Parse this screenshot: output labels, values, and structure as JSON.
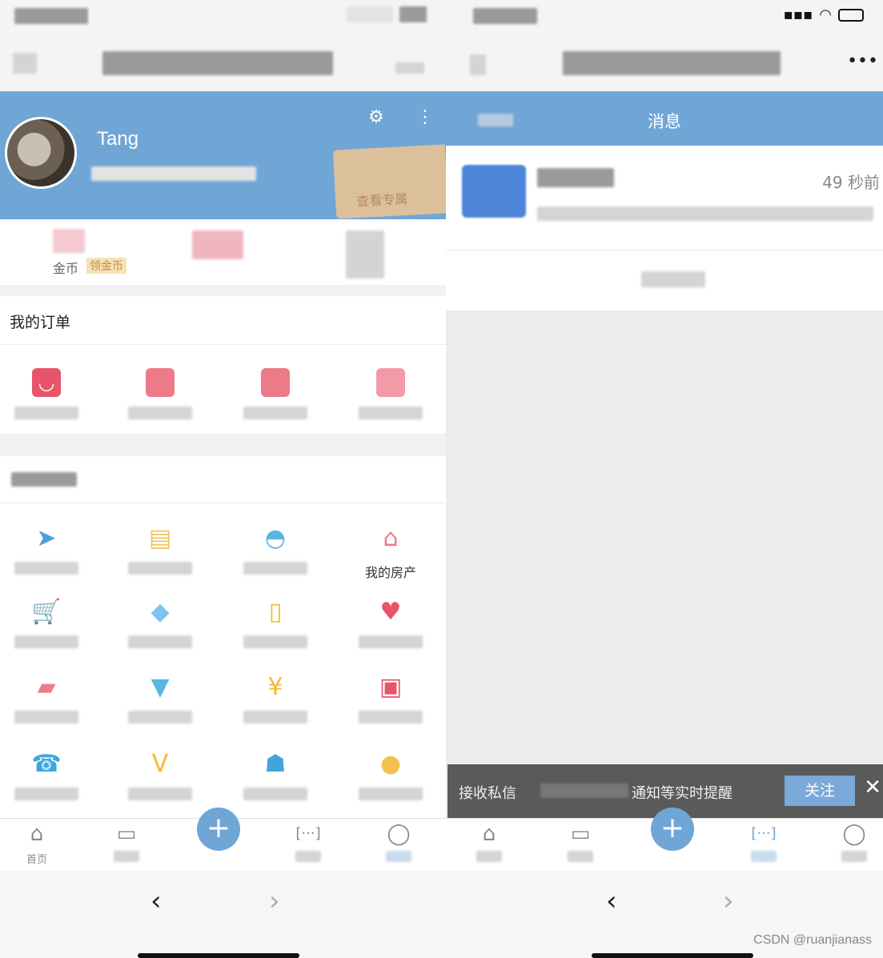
{
  "left": {
    "profile": {
      "name": "Tang",
      "view_button": "查看专属",
      "settings_icon": "gear-icon",
      "more_icon": "more-vertical-icon"
    },
    "coins": {
      "label": "金币",
      "sub_label": "领金币"
    },
    "orders": {
      "title": "我的订单"
    },
    "services": {
      "items": [
        {
          "icon": "paper-plane-icon",
          "label": "",
          "color": "#4a9fd8"
        },
        {
          "icon": "bag-icon",
          "label": "",
          "color": "#f2c35c"
        },
        {
          "icon": "basket-icon",
          "label": "",
          "color": "#58b6e3"
        },
        {
          "icon": "house-icon",
          "label": "我的房产",
          "color": "#ef7b8a"
        },
        {
          "icon": "cart-icon",
          "label": "",
          "color": "#f5b82e"
        },
        {
          "icon": "diamond-icon",
          "label": "",
          "color": "#7cc4ef"
        },
        {
          "icon": "door-icon",
          "label": "",
          "color": "#f5b82e"
        },
        {
          "icon": "heart-icon",
          "label": "",
          "color": "#e8556b"
        },
        {
          "icon": "tag-icon",
          "label": "",
          "color": "#ef7b8a"
        },
        {
          "icon": "shirt-icon",
          "label": "",
          "color": "#58b6e3"
        },
        {
          "icon": "ticket-icon",
          "label": "",
          "color": "#f5b82e"
        },
        {
          "icon": "gift-icon",
          "label": "",
          "color": "#e8556b"
        },
        {
          "icon": "phone-icon",
          "label": "",
          "color": "#3fa6dc"
        },
        {
          "icon": "vip-icon",
          "label": "",
          "color": "#f5b82e"
        },
        {
          "icon": "service-icon",
          "label": "",
          "color": "#3fa6dc"
        },
        {
          "icon": "user-icon",
          "label": "",
          "color": "#f5c14e"
        }
      ]
    },
    "tabs": [
      {
        "icon": "home-icon",
        "label": "首页"
      },
      {
        "icon": "shop-icon",
        "label": ""
      },
      {
        "icon": "plus-icon",
        "label": ""
      },
      {
        "icon": "message-icon",
        "label": ""
      },
      {
        "icon": "profile-icon",
        "label": ""
      }
    ]
  },
  "right": {
    "page_title": "消息",
    "message": {
      "time": "49 秒前"
    },
    "follow_banner": {
      "text": "接收私信",
      "text2": "通知等实时提醒",
      "button": "关注"
    },
    "tabs": [
      {
        "icon": "home-icon",
        "label": ""
      },
      {
        "icon": "shop-icon",
        "label": ""
      },
      {
        "icon": "plus-icon",
        "label": ""
      },
      {
        "icon": "message-icon",
        "label": ""
      },
      {
        "icon": "profile-icon",
        "label": ""
      }
    ]
  },
  "watermark": "CSDN @ruanjianass",
  "colors": {
    "primary": "#6fa6d6",
    "banner": "#5a5a5a"
  }
}
